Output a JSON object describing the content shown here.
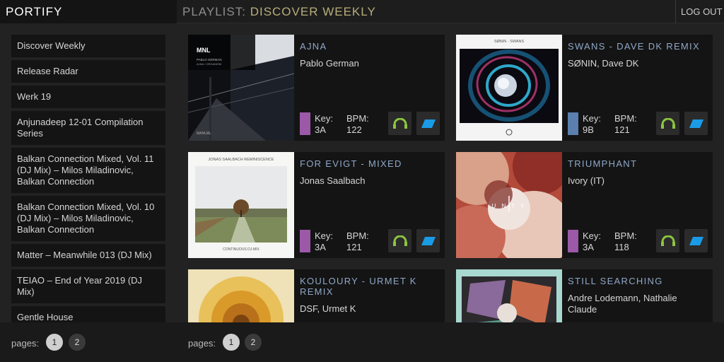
{
  "app": {
    "name": "PORTIFY"
  },
  "header": {
    "playlist_prefix": "PLAYLIST:",
    "playlist_name": "DISCOVER WEEKLY",
    "logout_label": "LOG OUT"
  },
  "sidebar": {
    "items": [
      {
        "label": "Discover Weekly"
      },
      {
        "label": "Release Radar"
      },
      {
        "label": "Werk 19"
      },
      {
        "label": "Anjunadeep 12-01 Compilation Series"
      },
      {
        "label": "Balkan Connection Mixed, Vol. 11 (DJ Mix) – Milos Miladinovic, Balkan Connection"
      },
      {
        "label": "Balkan Connection Mixed, Vol. 10 (DJ Mix) – Milos Miladinovic, Balkan Connection"
      },
      {
        "label": "Matter – Meanwhile 013 (DJ Mix)"
      },
      {
        "label": "TEIAO – End of Year 2019 (DJ Mix)"
      },
      {
        "label": "Gentle House"
      }
    ]
  },
  "tracks": [
    {
      "title": "AJNA",
      "artist": "Pablo German",
      "key_label": "Key:",
      "key": "3A",
      "bpm_label": "BPM:",
      "bpm": "122",
      "key_color": "#9b59a8",
      "cover_logo": "MNL",
      "cover_name": "PABLO GERMAN",
      "cover_sub": "AJNA / ORGANISM",
      "cover_foot": "MANUAL"
    },
    {
      "title": "SWANS - DAVE DK REMIX",
      "artist": "SØNIN, Dave DK",
      "key_label": "Key:",
      "key": "9B",
      "bpm_label": "BPM:",
      "bpm": "121",
      "key_color": "#5b7fae",
      "cover_head": "SØNIN · SWANS"
    },
    {
      "title": "FOR EVIGT - MIXED",
      "artist": "Jonas Saalbach",
      "key_label": "Key:",
      "key": "3A",
      "bpm_label": "BPM:",
      "bpm": "121",
      "key_color": "#9b59a8",
      "cover_head": "JONAS SAALBACH  REMINISCENCE",
      "cover_foot": "CONTINUOUS DJ-MIX"
    },
    {
      "title": "TRIUMPHANT",
      "artist": "Ivory (IT)",
      "key_label": "Key:",
      "key": "3A",
      "bpm_label": "BPM:",
      "bpm": "118",
      "key_color": "#9b59a8",
      "cover_word": "U N   T Y"
    },
    {
      "title": "KOULOURY - URMET K REMIX",
      "artist": "DSF, Urmet K",
      "key_label": "Key:",
      "key": "",
      "bpm_label": "BPM:",
      "bpm": "",
      "key_color": "#9b59a8"
    },
    {
      "title": "STILL SEARCHING",
      "artist": "Andre Lodemann, Nathalie Claude",
      "key_label": "Key:",
      "key": "",
      "bpm_label": "BPM:",
      "bpm": "",
      "key_color": "#9b59a8"
    }
  ],
  "pagination": {
    "label": "pages:",
    "pages": [
      "1",
      "2"
    ],
    "current": "1"
  },
  "colors": {
    "accent_title": "#8fa8c8",
    "playlist_name": "#b8ad7a",
    "beatport_green": "#8cc63f",
    "beatport_blue": "#1a9be6"
  },
  "icons": {
    "play_button": "headphones-icon",
    "store_button": "parallelogram-icon"
  }
}
